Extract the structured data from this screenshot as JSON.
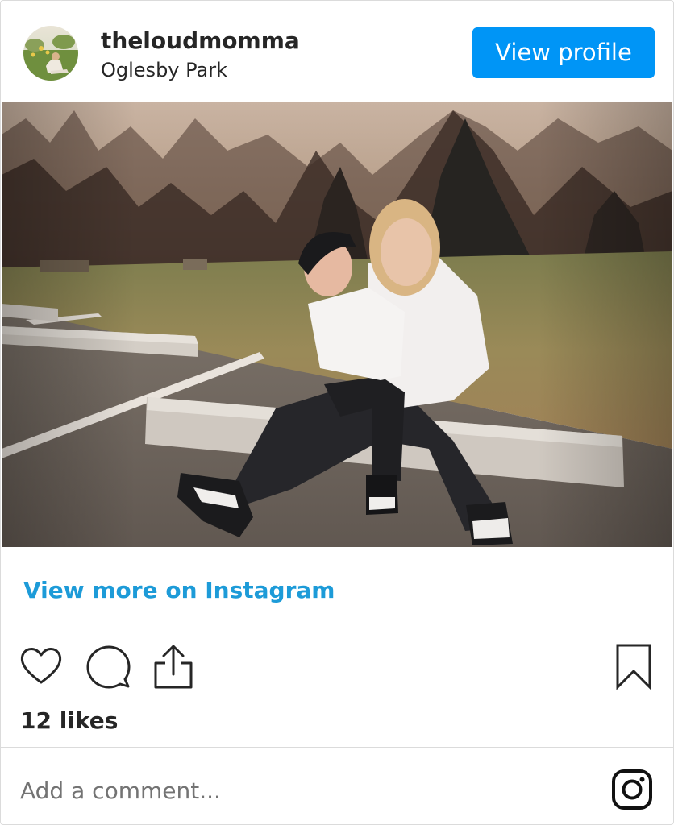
{
  "header": {
    "username": "theloudmomma",
    "location": "Oglesby Park",
    "view_profile_label": "View profile",
    "avatar_icon": "profile-photo"
  },
  "post": {
    "image_icon": "post-photo",
    "view_more_label": "View more on Instagram",
    "likes_text": "12 likes"
  },
  "actions": {
    "like_icon": "heart-icon",
    "comment_icon": "comment-bubble-icon",
    "share_icon": "share-upload-icon",
    "save_icon": "bookmark-icon"
  },
  "comment": {
    "placeholder": "Add a comment..."
  },
  "footer": {
    "logo_icon": "instagram-logo-icon"
  },
  "colors": {
    "brand_blue": "#0095f6",
    "link_blue": "#1d9bd8",
    "text": "#262626",
    "muted": "#737373",
    "divider": "#dbdbdb"
  }
}
